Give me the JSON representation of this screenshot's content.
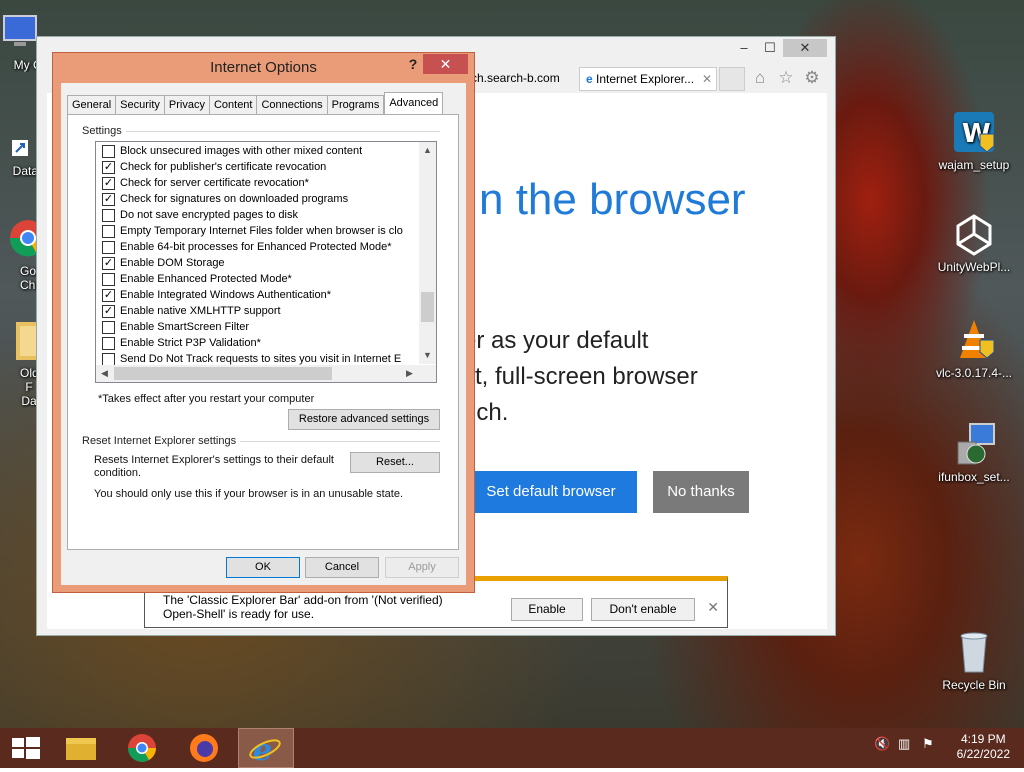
{
  "desktop": {
    "left_icons": [
      {
        "label": "My Co"
      },
      {
        "label": "DataW"
      },
      {
        "label": "Goo Chr"
      },
      {
        "label": "Old F Da"
      }
    ],
    "right_icons": [
      {
        "label": "wajam_setup"
      },
      {
        "label": "UnityWebPl..."
      },
      {
        "label": "vlc-3.0.17.4-..."
      },
      {
        "label": "ifunbox_set..."
      },
      {
        "label": "Recycle Bin"
      }
    ]
  },
  "browser": {
    "tab_url": "rch.search-b.com",
    "tab_active": "Internet Explorer...",
    "hero": "n the browser",
    "lines": [
      "er as your default",
      "st, full-screen browser",
      "uch."
    ],
    "set_default": "Set default browser",
    "no_thanks": "No thanks"
  },
  "notification": {
    "message": "The 'Classic Explorer Bar' add-on from '(Not verified) Open-Shell' is ready for use.",
    "enable": "Enable",
    "dont_enable": "Don't enable"
  },
  "dialog": {
    "title": "Internet Options",
    "help": "?",
    "tabs": [
      "General",
      "Security",
      "Privacy",
      "Content",
      "Connections",
      "Programs",
      "Advanced"
    ],
    "settings_label": "Settings",
    "options": [
      {
        "label": "Block unsecured images with other mixed content",
        "checked": false
      },
      {
        "label": "Check for publisher's certificate revocation",
        "checked": true
      },
      {
        "label": "Check for server certificate revocation*",
        "checked": true
      },
      {
        "label": "Check for signatures on downloaded programs",
        "checked": true
      },
      {
        "label": "Do not save encrypted pages to disk",
        "checked": false
      },
      {
        "label": "Empty Temporary Internet Files folder when browser is clo",
        "checked": false
      },
      {
        "label": "Enable 64-bit processes for Enhanced Protected Mode*",
        "checked": false
      },
      {
        "label": "Enable DOM Storage",
        "checked": true
      },
      {
        "label": "Enable Enhanced Protected Mode*",
        "checked": false
      },
      {
        "label": "Enable Integrated Windows Authentication*",
        "checked": true
      },
      {
        "label": "Enable native XMLHTTP support",
        "checked": true
      },
      {
        "label": "Enable SmartScreen Filter",
        "checked": false
      },
      {
        "label": "Enable Strict P3P Validation*",
        "checked": false
      },
      {
        "label": "Send Do Not Track requests to sites you visit in Internet E",
        "checked": false
      }
    ],
    "restart_note": "*Takes effect after you restart your computer",
    "restore_button": "Restore advanced settings",
    "reset_group": "Reset Internet Explorer settings",
    "reset_desc": "Resets Internet Explorer's settings to their default condition.",
    "reset_button": "Reset...",
    "reset_warning": "You should only use this if your browser is in an unusable state.",
    "ok": "OK",
    "cancel": "Cancel",
    "apply": "Apply"
  },
  "taskbar": {
    "time": "4:19 PM",
    "date": "6/22/2022"
  }
}
